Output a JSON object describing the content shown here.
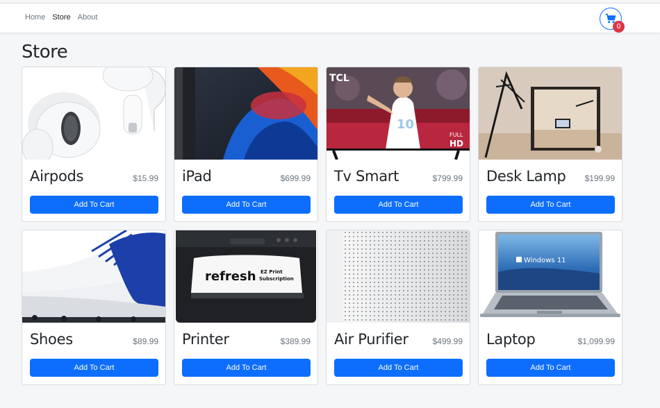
{
  "nav": {
    "links": [
      {
        "label": "Home",
        "active": false
      },
      {
        "label": "Store",
        "active": true
      },
      {
        "label": "About",
        "active": false
      }
    ],
    "cart_count": "0",
    "cart_icon": "shopping-cart-icon"
  },
  "page": {
    "title": "Store"
  },
  "products": [
    {
      "name": "Airpods",
      "price": "$15.99",
      "button": "Add To Cart"
    },
    {
      "name": "iPad",
      "price": "$699.99",
      "button": "Add To Cart"
    },
    {
      "name": "Tv Smart",
      "price": "$799.99",
      "button": "Add To Cart",
      "image_text": [
        "TCL",
        "10",
        "FULL",
        "HD"
      ]
    },
    {
      "name": "Desk Lamp",
      "price": "$199.99",
      "button": "Add To Cart"
    },
    {
      "name": "Shoes",
      "price": "$89.99",
      "button": "Add To Cart"
    },
    {
      "name": "Printer",
      "price": "$389.99",
      "button": "Add To Cart",
      "image_text": [
        "refresh",
        "EZ Print",
        "Subscription"
      ]
    },
    {
      "name": "Air Purifier",
      "price": "$499.99",
      "button": "Add To Cart"
    },
    {
      "name": "Laptop",
      "price": "$1,099.99",
      "button": "Add To Cart",
      "image_text": [
        "Windows 11"
      ]
    }
  ],
  "colors": {
    "primary": "#0d6efd",
    "badge": "#dc3545",
    "background": "#f5f6f8"
  }
}
